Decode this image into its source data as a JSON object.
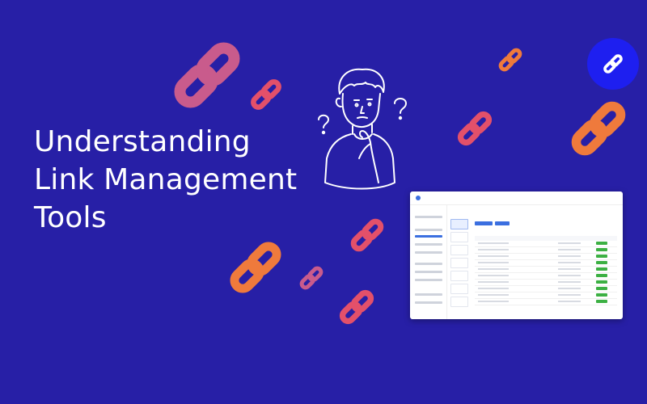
{
  "title": {
    "line1": "Understanding",
    "line2": "Link Management",
    "line3": "Tools"
  },
  "badge": {
    "icon": "link-icon",
    "background": "#1e1ff0"
  },
  "colors": {
    "background": "#271fa6",
    "chain_pink": "#d9587a",
    "chain_orange": "#ef7a3c",
    "chain_red": "#e3506a"
  },
  "illustration": {
    "figure": "confused-person-with-question-marks"
  },
  "screenshot": {
    "description_icon": "app-dashboard-preview"
  }
}
